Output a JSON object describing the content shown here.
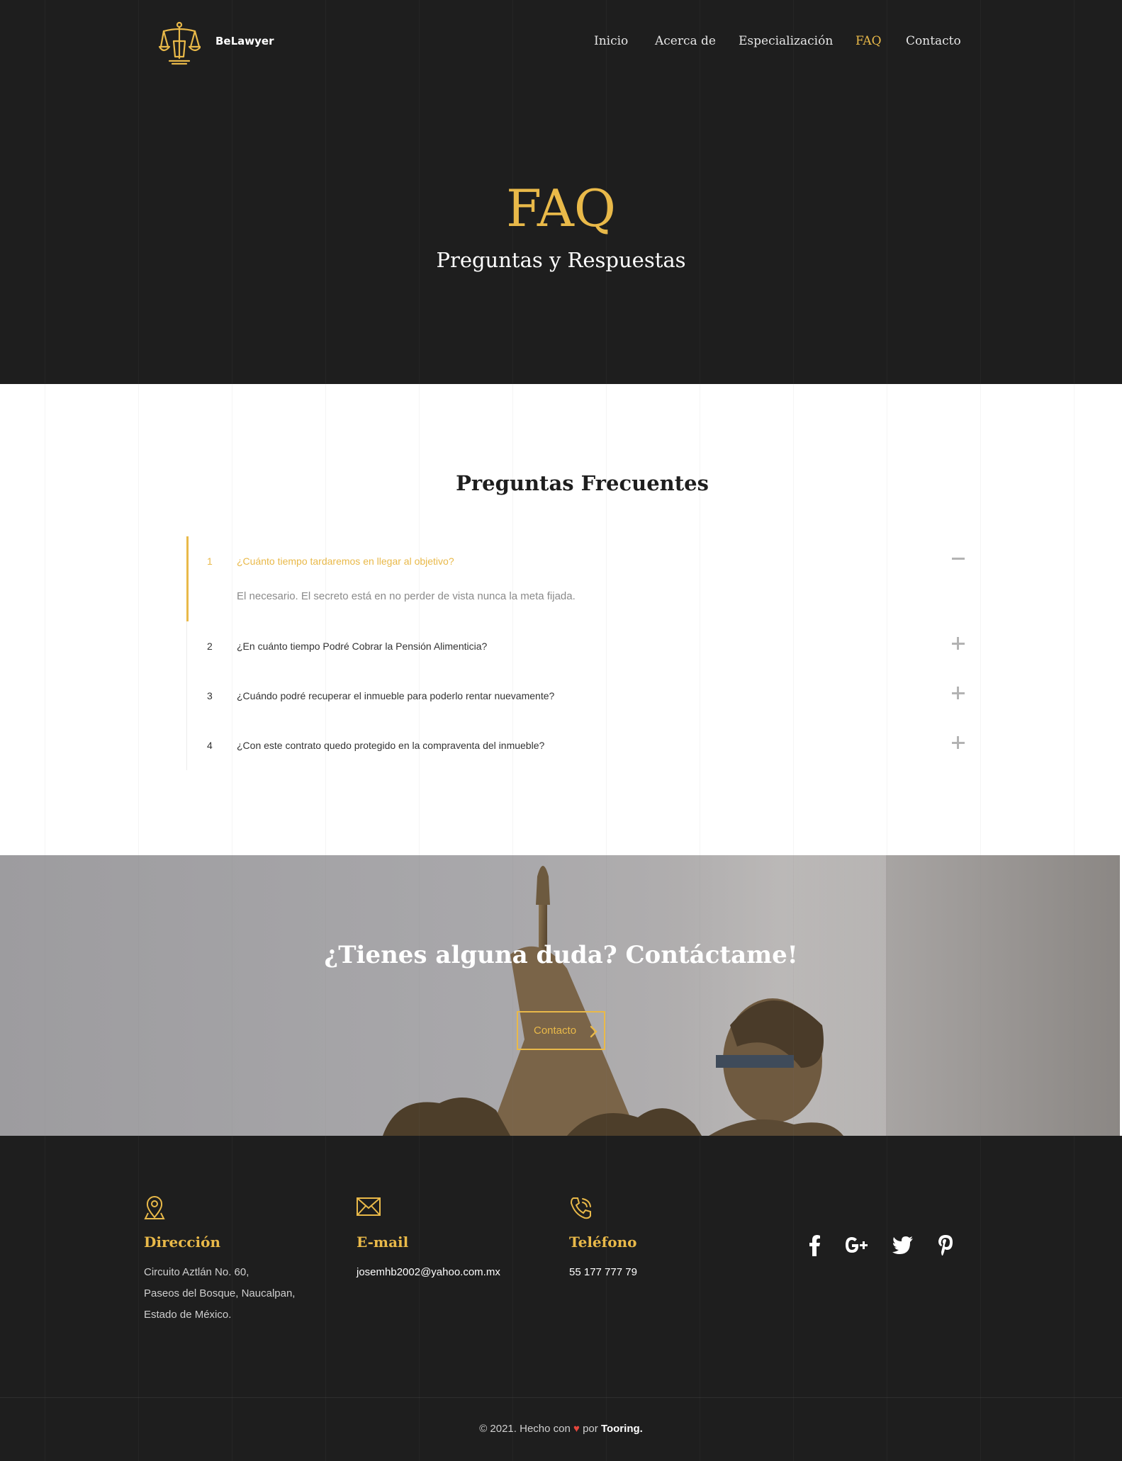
{
  "header": {
    "brand": "BeLawyer",
    "nav": [
      "Inicio",
      "Acerca de",
      "Especialización",
      "FAQ",
      "Contacto"
    ],
    "active_nav": "FAQ"
  },
  "hero": {
    "title": "FAQ",
    "subtitle": "Preguntas y Respuestas"
  },
  "faq": {
    "heading": "Preguntas Frecuentes",
    "items": [
      {
        "number": "1",
        "question": "¿Cuánto tiempo tardaremos en llegar al objetivo?",
        "answer": "El necesario. El secreto está en no perder de vista nunca la meta fijada.",
        "expanded": true
      },
      {
        "number": "2",
        "question": "¿En cuánto tiempo Podré Cobrar la Pensión Alimenticia?",
        "expanded": false
      },
      {
        "number": "3",
        "question": "¿Cuándo podré recuperar el inmueble para poderlo rentar nuevamente?",
        "expanded": false
      },
      {
        "number": "4",
        "question": "¿Con este contrato quedo protegido en la compraventa del inmueble?",
        "expanded": false
      }
    ]
  },
  "cta": {
    "title": "¿Tienes alguna duda? Contáctame!",
    "button_label": "Contacto"
  },
  "footer": {
    "address": {
      "title": "Dirección",
      "lines": [
        "Circuito Aztlán No. 60,",
        "Paseos del Bosque, Naucalpan,",
        "Estado de México."
      ]
    },
    "email": {
      "title": "E-mail",
      "value": "josemhb2002@yahoo.com.mx"
    },
    "phone": {
      "title": "Teléfono",
      "value": "55 177 777 79"
    },
    "social": [
      "facebook-icon",
      "google-plus-icon",
      "twitter-icon",
      "pinterest-icon"
    ],
    "copyright": {
      "text_before": "© 2021. Hecho con",
      "heart": "♥",
      "text_after": "por",
      "credit": "Tooring."
    }
  },
  "colors": {
    "accent": "#e9b949",
    "dark": "#1e1e1e",
    "heart": "#e4463c"
  }
}
